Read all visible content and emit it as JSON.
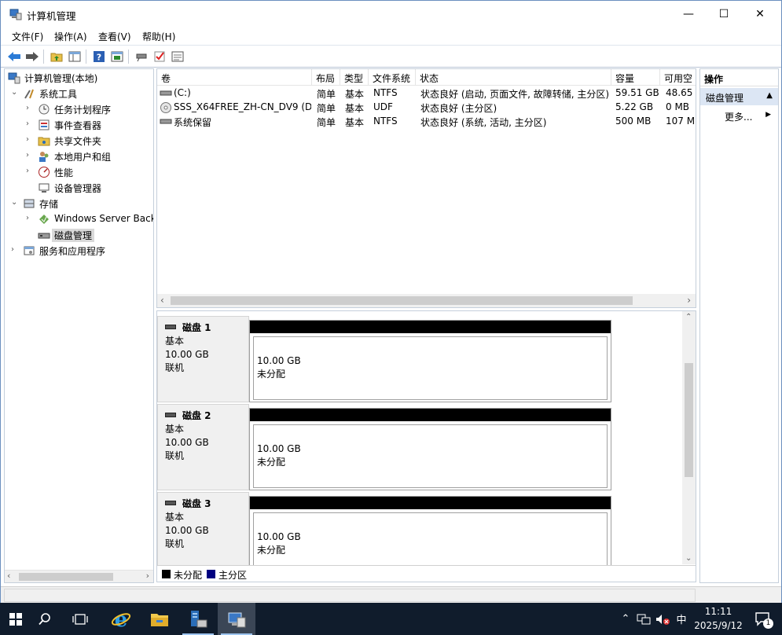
{
  "window": {
    "title": "计算机管理",
    "minimize_glyph": "—",
    "maximize_glyph": "☐",
    "close_glyph": "✕"
  },
  "menu": [
    "文件(F)",
    "操作(A)",
    "查看(V)",
    "帮助(H)"
  ],
  "toolbar": {
    "icons": [
      "back-icon",
      "forward-icon",
      "up-folder-icon",
      "show-hide-tree-icon",
      "help-icon",
      "properties-icon",
      "connect-icon",
      "check-icon",
      "console-icon"
    ]
  },
  "tree": [
    {
      "label": "计算机管理(本地)",
      "icon": "computer-management-icon",
      "level": 0,
      "arrow": ""
    },
    {
      "label": "系统工具",
      "icon": "system-tools-icon",
      "level": 1,
      "arrow": "⌄"
    },
    {
      "label": "任务计划程序",
      "icon": "task-scheduler-icon",
      "level": 2,
      "arrow": "›"
    },
    {
      "label": "事件查看器",
      "icon": "event-viewer-icon",
      "level": 2,
      "arrow": "›"
    },
    {
      "label": "共享文件夹",
      "icon": "shared-folders-icon",
      "level": 2,
      "arrow": "›"
    },
    {
      "label": "本地用户和组",
      "icon": "local-users-icon",
      "level": 2,
      "arrow": "›"
    },
    {
      "label": "性能",
      "icon": "performance-icon",
      "level": 2,
      "arrow": "›"
    },
    {
      "label": "设备管理器",
      "icon": "device-manager-icon",
      "level": 2,
      "arrow": ""
    },
    {
      "label": "存储",
      "icon": "storage-icon",
      "level": 1,
      "arrow": "⌄"
    },
    {
      "label": "Windows Server Back",
      "icon": "windows-server-backup-icon",
      "level": 2,
      "arrow": "›"
    },
    {
      "label": "磁盘管理",
      "icon": "disk-management-icon",
      "level": 2,
      "arrow": "",
      "selected": true
    },
    {
      "label": "服务和应用程序",
      "icon": "services-apps-icon",
      "level": 1,
      "arrow": "›"
    }
  ],
  "volumes": {
    "columns": [
      "卷",
      "布局",
      "类型",
      "文件系统",
      "状态",
      "容量",
      "可用空"
    ],
    "rows": [
      {
        "icon": "volume-icon",
        "name": "(C:)",
        "layout": "简单",
        "type": "基本",
        "fs": "NTFS",
        "status": "状态良好 (启动, 页面文件, 故障转储, 主分区)",
        "capacity": "59.51 GB",
        "free": "48.65"
      },
      {
        "icon": "cd-drive-icon",
        "name": "SSS_X64FREE_ZH-CN_DV9 (D:)",
        "layout": "简单",
        "type": "基本",
        "fs": "UDF",
        "status": "状态良好 (主分区)",
        "capacity": "5.22 GB",
        "free": "0 MB"
      },
      {
        "icon": "volume-icon",
        "name": "系统保留",
        "layout": "简单",
        "type": "基本",
        "fs": "NTFS",
        "status": "状态良好 (系统, 活动, 主分区)",
        "capacity": "500 MB",
        "free": "107 M"
      }
    ]
  },
  "disks": [
    {
      "name": "磁盘 1",
      "type": "基本",
      "size": "10.00 GB",
      "state": "联机",
      "part_size": "10.00 GB",
      "part_state": "未分配"
    },
    {
      "name": "磁盘 2",
      "type": "基本",
      "size": "10.00 GB",
      "state": "联机",
      "part_size": "10.00 GB",
      "part_state": "未分配"
    },
    {
      "name": "磁盘 3",
      "type": "基本",
      "size": "10.00 GB",
      "state": "联机",
      "part_size": "10.00 GB",
      "part_state": "未分配"
    }
  ],
  "legend": {
    "unallocated": "未分配",
    "primary": "主分区",
    "unallocated_color": "#000000",
    "primary_color": "#000080"
  },
  "actions": {
    "header": "操作",
    "section": "磁盘管理",
    "more": "更多..."
  },
  "taskbar": {
    "items": [
      "start-icon",
      "search-icon",
      "task-view-icon",
      "internet-explorer-icon",
      "file-explorer-icon",
      "server-manager-icon",
      "computer-management-icon"
    ],
    "ime": "中",
    "time": "11:11",
    "date": "2025/9/12",
    "notification_count": "1"
  }
}
